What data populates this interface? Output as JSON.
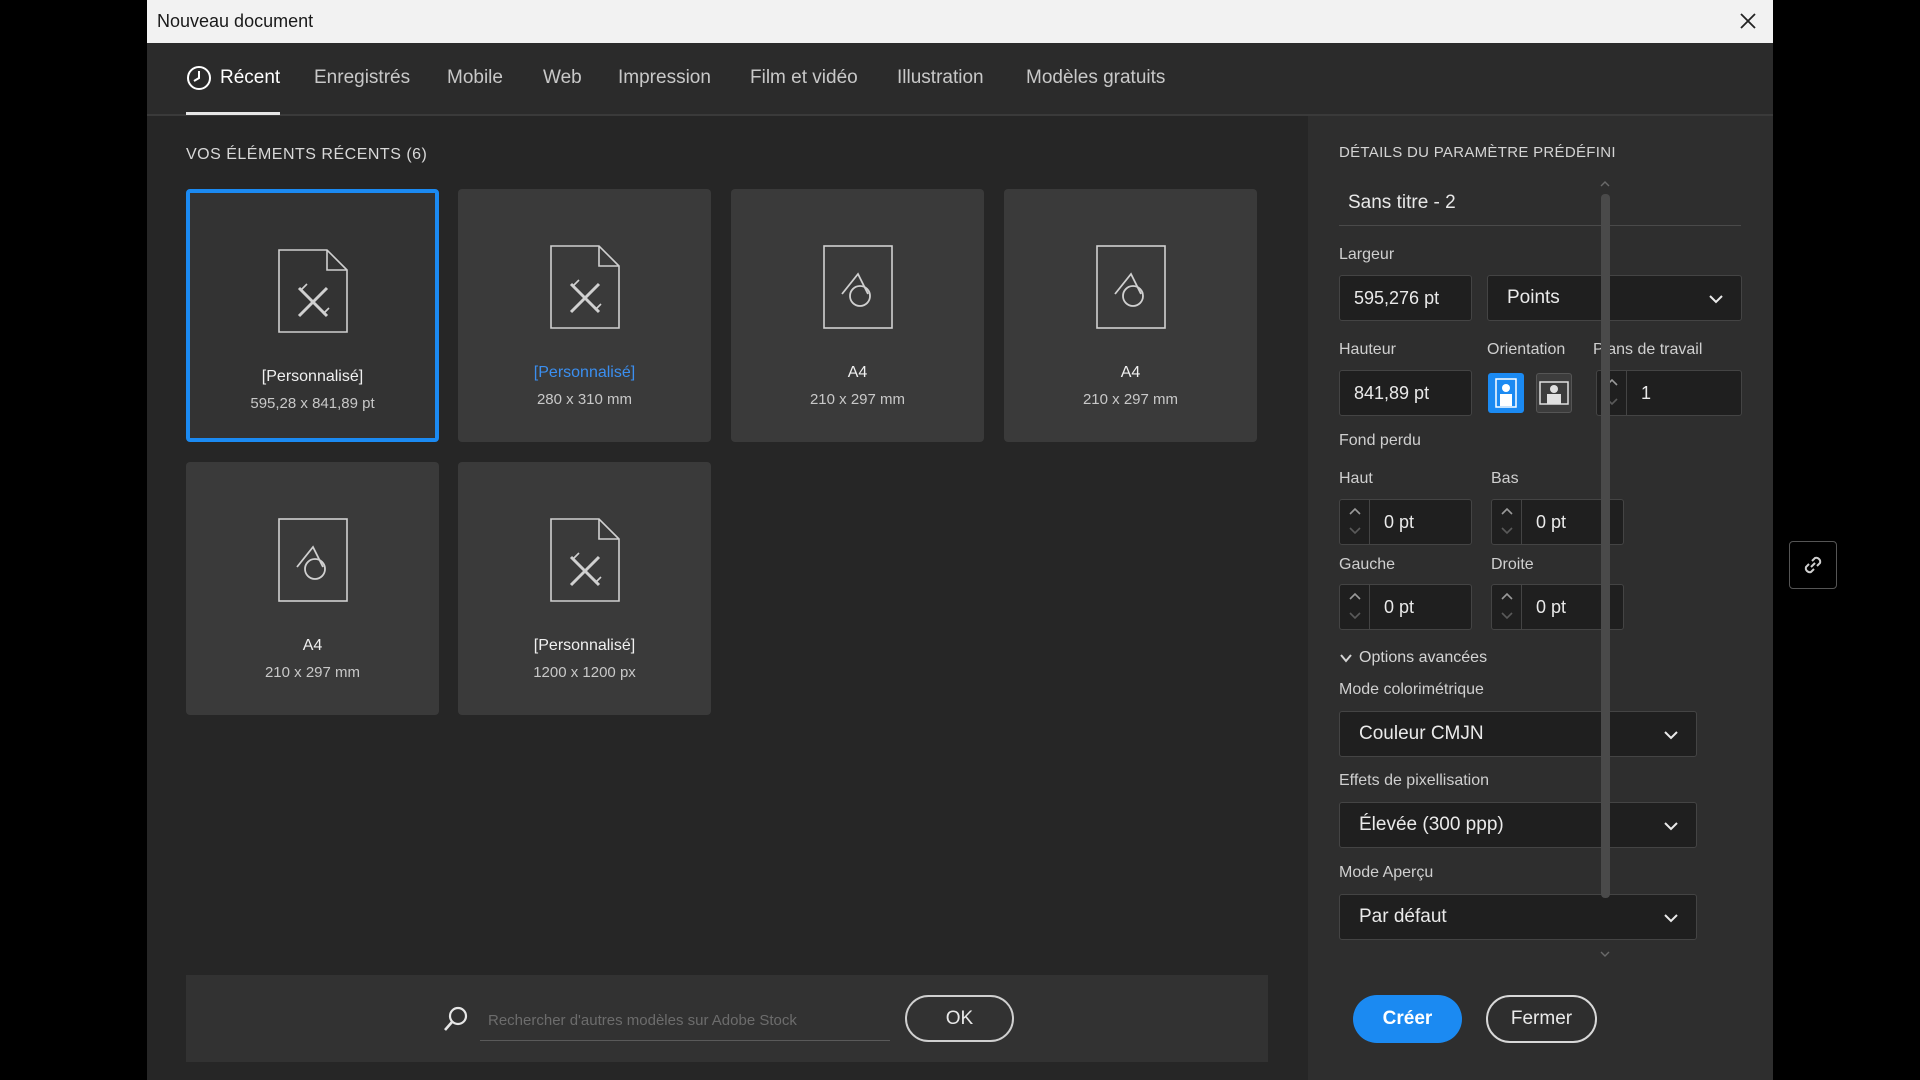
{
  "window": {
    "title": "Nouveau document"
  },
  "tabs": [
    {
      "label": "Récent",
      "active": true
    },
    {
      "label": "Enregistrés"
    },
    {
      "label": "Mobile"
    },
    {
      "label": "Web"
    },
    {
      "label": "Impression"
    },
    {
      "label": "Film et vidéo"
    },
    {
      "label": "Illustration"
    },
    {
      "label": "Modèles gratuits"
    }
  ],
  "recent": {
    "title": "VOS ÉLÉMENTS RÉCENTS",
    "count": "(6)",
    "items": [
      {
        "name": "[Personnalisé]",
        "size": "595,28 x 841,89 pt",
        "icon": "custom-document-icon",
        "selected": true
      },
      {
        "name": "[Personnalisé]",
        "size": "280 x 310 mm",
        "icon": "custom-document-icon",
        "highlight": true
      },
      {
        "name": "A4",
        "size": "210 x 297 mm",
        "icon": "shapes-document-icon"
      },
      {
        "name": "A4",
        "size": "210 x 297 mm",
        "icon": "shapes-document-icon"
      },
      {
        "name": "A4",
        "size": "210 x 297 mm",
        "icon": "shapes-document-icon"
      },
      {
        "name": "[Personnalisé]",
        "size": "1200 x 1200 px",
        "icon": "custom-document-icon"
      }
    ]
  },
  "search": {
    "placeholder": "Rechercher d'autres modèles sur Adobe Stock",
    "ok_label": "OK"
  },
  "preset": {
    "heading": "DÉTAILS DU PARAMÈTRE PRÉDÉFINI",
    "doc_name": "Sans titre - 2",
    "width_label": "Largeur",
    "width_value": "595,276 pt",
    "units": "Points",
    "height_label": "Hauteur",
    "height_value": "841,89 pt",
    "orientation_label": "Orientation",
    "artboards_label": "Plans de travail",
    "artboards_value": "1",
    "bleed_label": "Fond perdu",
    "top_label": "Haut",
    "top_value": "0 pt",
    "bottom_label": "Bas",
    "bottom_value": "0 pt",
    "left_label": "Gauche",
    "left_value": "0 pt",
    "right_label": "Droite",
    "right_value": "0 pt",
    "advanced_label": "Options avancées",
    "color_mode_label": "Mode colorimétrique",
    "color_mode_value": "Couleur CMJN",
    "raster_label": "Effets de pixellisation",
    "raster_value": "Élevée (300 ppp)",
    "preview_label": "Mode Aperçu",
    "preview_value": "Par défaut"
  },
  "actions": {
    "create": "Créer",
    "close": "Fermer"
  },
  "colors": {
    "accent": "#1b8af2",
    "panel": "#2e2e2e",
    "background": "#262626"
  }
}
